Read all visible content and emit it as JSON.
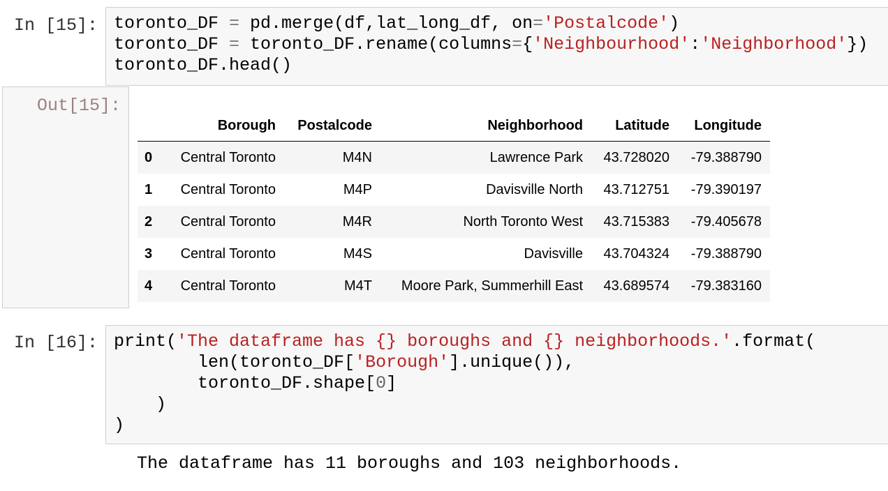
{
  "cell15": {
    "in_prompt": "In [15]:",
    "out_prompt": "Out[15]:",
    "code": {
      "l1a": "toronto_DF ",
      "l1eq": "=",
      "l1b": " pd.merge(df,lat_long_df, on",
      "l1eq2": "=",
      "l1s": "'Postalcode'",
      "l1c": ")",
      "l2a": "toronto_DF ",
      "l2eq": "=",
      "l2b": " toronto_DF.rename(columns",
      "l2eq2": "=",
      "l2c": "{",
      "l2s1": "'Neighbourhood'",
      "l2d": ":",
      "l2s2": "'Neighborhood'",
      "l2e": "})",
      "l3": "toronto_DF.head()"
    },
    "table": {
      "columns": [
        "",
        "Borough",
        "Postalcode",
        "Neighborhood",
        "Latitude",
        "Longitude"
      ],
      "rows": [
        [
          "0",
          "Central Toronto",
          "M4N",
          "Lawrence Park",
          "43.728020",
          "-79.388790"
        ],
        [
          "1",
          "Central Toronto",
          "M4P",
          "Davisville North",
          "43.712751",
          "-79.390197"
        ],
        [
          "2",
          "Central Toronto",
          "M4R",
          "North Toronto West",
          "43.715383",
          "-79.405678"
        ],
        [
          "3",
          "Central Toronto",
          "M4S",
          "Davisville",
          "43.704324",
          "-79.388790"
        ],
        [
          "4",
          "Central Toronto",
          "M4T",
          "Moore Park, Summerhill East",
          "43.689574",
          "-79.383160"
        ]
      ]
    }
  },
  "cell16": {
    "in_prompt": "In [16]:",
    "code": {
      "l1a": "print(",
      "l1s": "'The dataframe has {} boroughs and {} neighborhoods.'",
      "l1b": ".format(",
      "l2a": "        len(toronto_DF[",
      "l2s": "'Borough'",
      "l2b": "].unique()),",
      "l3a": "        toronto_DF.shape[",
      "l3n": "0",
      "l3b": "]",
      "l4": "    )",
      "l5": ")"
    },
    "output": "The dataframe has 11 boroughs and 103 neighborhoods."
  }
}
